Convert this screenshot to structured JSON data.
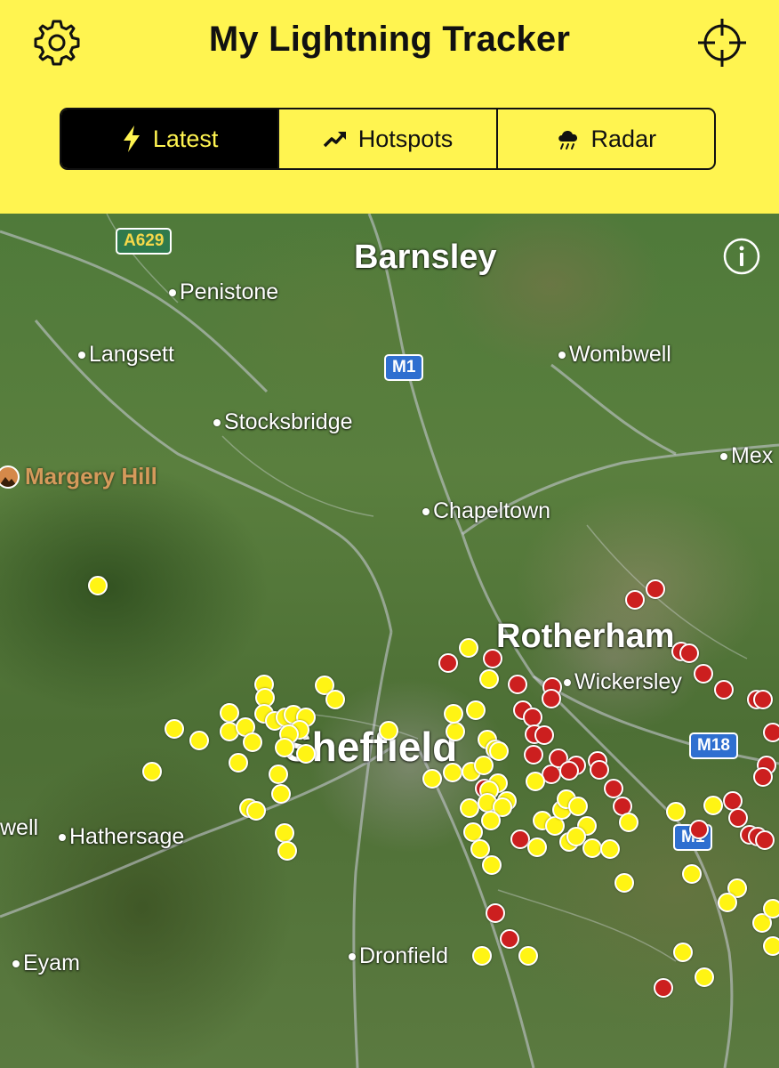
{
  "app": {
    "title": "My Lightning Tracker",
    "settings_icon": "gear-icon",
    "locate_icon": "crosshair-icon"
  },
  "tabs": [
    {
      "label": "Latest",
      "icon": "lightning-bolt-icon",
      "selected": true
    },
    {
      "label": "Hotspots",
      "icon": "trend-up-icon",
      "selected": false
    },
    {
      "label": "Radar",
      "icon": "rain-cloud-icon",
      "selected": false
    }
  ],
  "colors": {
    "header_bg": "#fff450",
    "recent_strike": "#fff414",
    "older_strike": "#cc1f1f"
  },
  "map": {
    "info_icon": "info-icon",
    "places": {
      "barnsley": "Barnsley",
      "penistone": "Penistone",
      "langsett": "Langsett",
      "wombwell": "Wombwell",
      "stocksbridge": "Stocksbridge",
      "margery_hill": "Margery Hill",
      "mex": "Mex",
      "chapeltown": "Chapeltown",
      "rotherham": "Rotherham",
      "wickersley": "Wickersley",
      "sheffield": "Sheffield",
      "well": "well",
      "hathersage": "Hathersage",
      "eyam": "Eyam",
      "dronfield": "Dronfield"
    },
    "road_labels": {
      "a629": "A629",
      "m1_north": "M1",
      "m18": "M18",
      "m1_south": "M1"
    }
  }
}
